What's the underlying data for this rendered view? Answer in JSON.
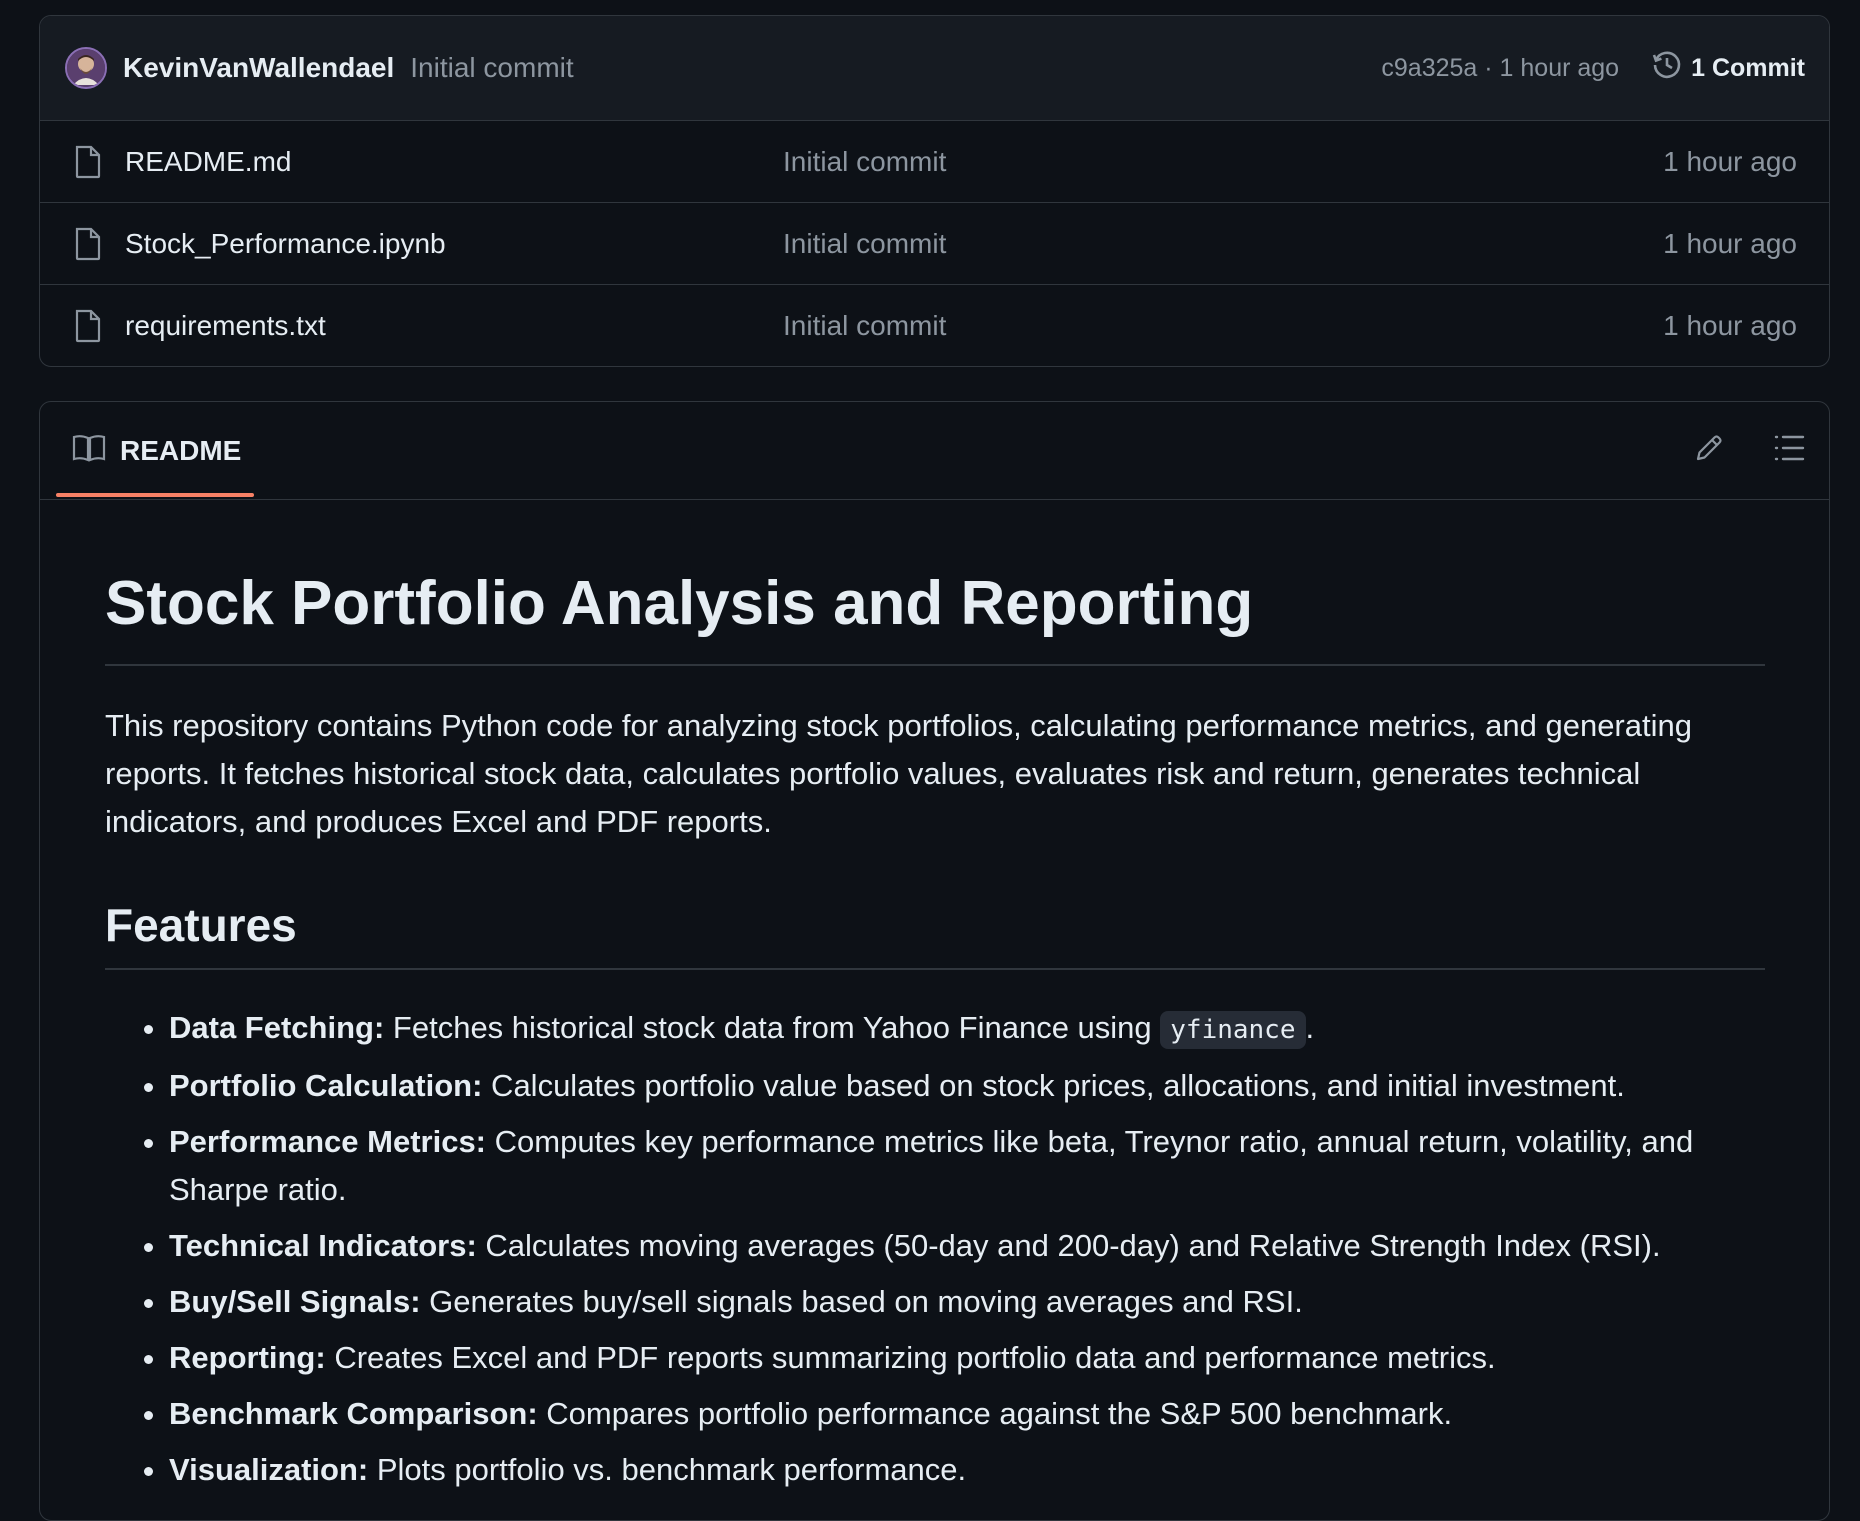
{
  "commit_bar": {
    "author": "KevinVanWallendael",
    "message": "Initial commit",
    "meta": "c9a325a · 1 hour ago",
    "commits_label": "1 Commit"
  },
  "files": [
    {
      "name": "README.md",
      "commit": "Initial commit",
      "time": "1 hour ago"
    },
    {
      "name": "Stock_Performance.ipynb",
      "commit": "Initial commit",
      "time": "1 hour ago"
    },
    {
      "name": "requirements.txt",
      "commit": "Initial commit",
      "time": "1 hour ago"
    }
  ],
  "readme": {
    "tab_label": "README",
    "title": "Stock Portfolio Analysis and Reporting",
    "intro": "This repository contains Python code for analyzing stock portfolios, calculating performance metrics, and generating reports. It fetches historical stock data, calculates portfolio values, evaluates risk and return, generates technical indicators, and produces Excel and PDF reports.",
    "features_heading": "Features",
    "features": [
      {
        "label": "Data Fetching:",
        "text": " Fetches historical stock data from Yahoo Finance using ",
        "code": "yfinance",
        "after": "."
      },
      {
        "label": "Portfolio Calculation:",
        "text": " Calculates portfolio value based on stock prices, allocations, and initial investment."
      },
      {
        "label": "Performance Metrics:",
        "text": " Computes key performance metrics like beta, Treynor ratio, annual return, volatility, and Sharpe ratio."
      },
      {
        "label": "Technical Indicators:",
        "text": " Calculates moving averages (50-day and 200-day) and Relative Strength Index (RSI)."
      },
      {
        "label": "Buy/Sell Signals:",
        "text": " Generates buy/sell signals based on moving averages and RSI."
      },
      {
        "label": "Reporting:",
        "text": " Creates Excel and PDF reports summarizing portfolio data and performance metrics."
      },
      {
        "label": "Benchmark Comparison:",
        "text": " Compares portfolio performance against the S&P 500 benchmark."
      },
      {
        "label": "Visualization:",
        "text": " Plots portfolio vs. benchmark performance."
      }
    ]
  },
  "icons": {
    "history": "history-icon",
    "file": "file-icon",
    "book": "book-icon",
    "edit": "pencil-icon",
    "outline": "list-icon"
  },
  "colors": {
    "background": "#0d1117",
    "tab_accent": "#f78166",
    "muted_text": "#8d96a0"
  }
}
